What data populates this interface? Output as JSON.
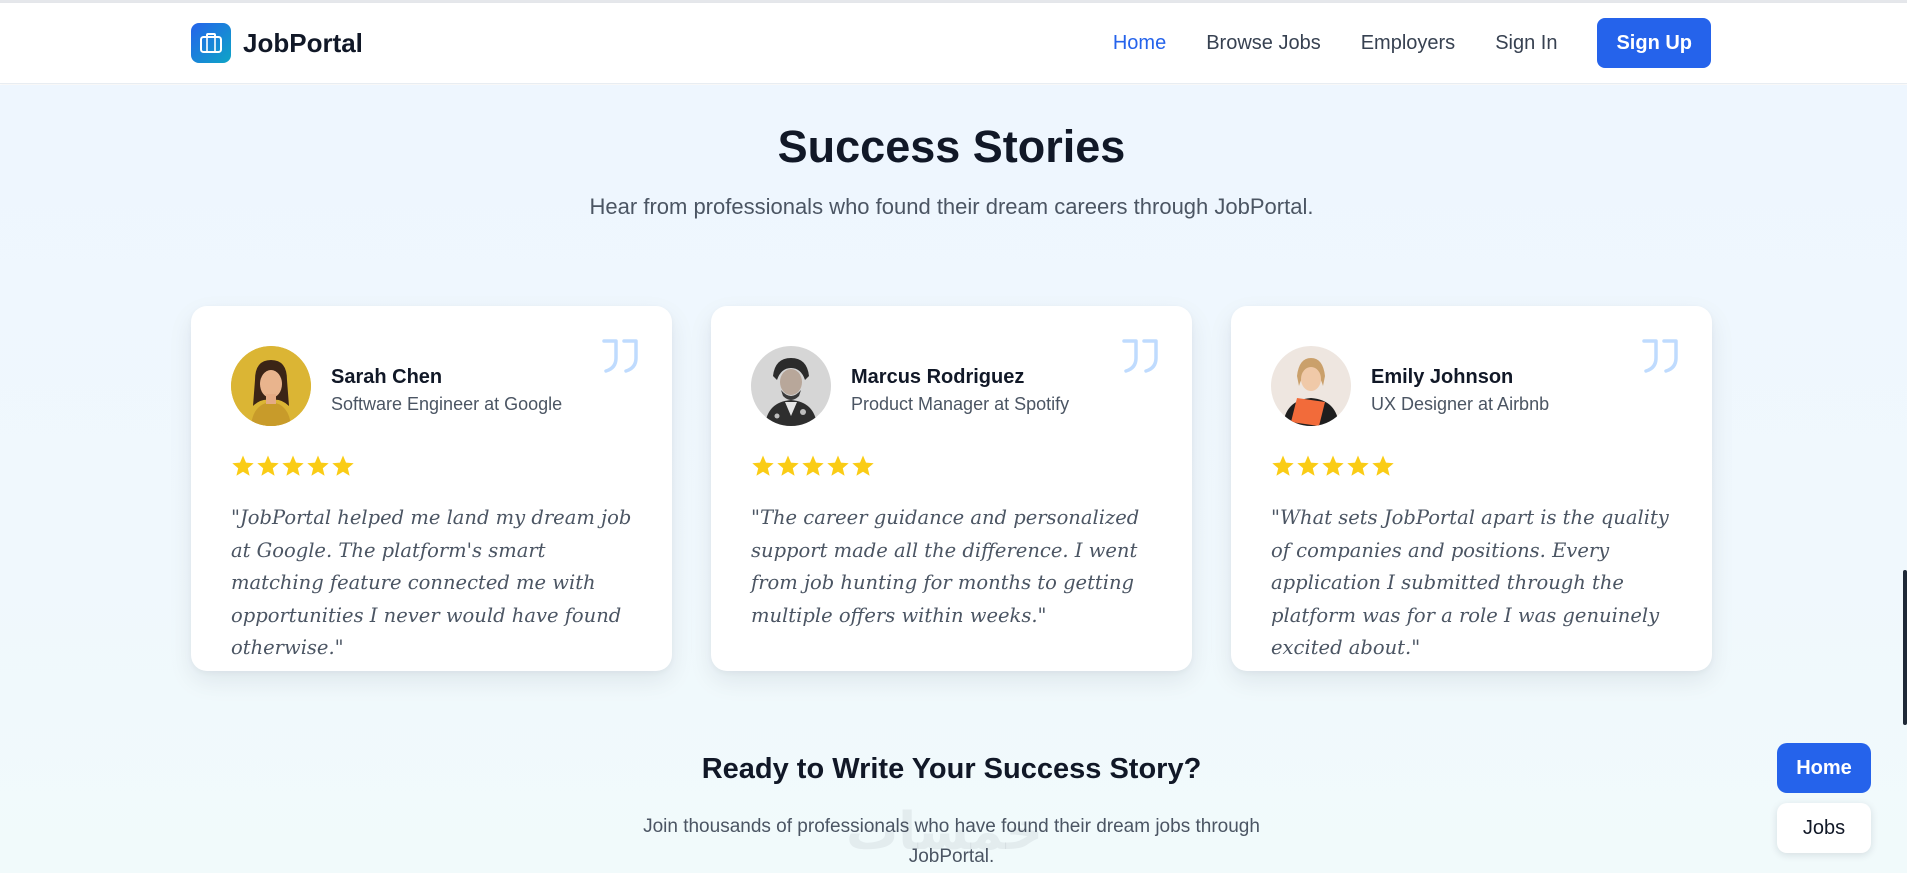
{
  "brand": {
    "name": "JobPortal",
    "icon": "briefcase-icon"
  },
  "nav": {
    "links": [
      {
        "label": "Home",
        "active": true
      },
      {
        "label": "Browse Jobs",
        "active": false
      },
      {
        "label": "Employers",
        "active": false
      },
      {
        "label": "Sign In",
        "active": false
      }
    ],
    "signup_label": "Sign Up"
  },
  "section": {
    "title": "Success Stories",
    "subtitle": "Hear from professionals who found their dream careers through JobPortal."
  },
  "testimonials": [
    {
      "name": "Sarah Chen",
      "role": "Software Engineer at Google",
      "rating": 5,
      "quote": "\"JobPortal helped me land my dream job at Google. The platform's smart matching feature connected me with opportunities I never would have found otherwise.\""
    },
    {
      "name": "Marcus Rodriguez",
      "role": "Product Manager at Spotify",
      "rating": 5,
      "quote": "\"The career guidance and personalized support made all the difference. I went from job hunting for months to getting multiple offers within weeks.\""
    },
    {
      "name": "Emily Johnson",
      "role": "UX Designer at Airbnb",
      "rating": 5,
      "quote": "\"What sets JobPortal apart is the quality of companies and positions. Every application I submitted through the platform was for a role I was genuinely excited about.\""
    }
  ],
  "cta": {
    "title": "Ready to Write Your Success Story?",
    "text": "Join thousands of professionals who have found their dream jobs through JobPortal."
  },
  "floating": {
    "home_label": "Home",
    "jobs_label": "Jobs"
  },
  "colors": {
    "accent": "#2563eb",
    "star": "#facc15",
    "quote_icon": "#bfdbfe"
  }
}
